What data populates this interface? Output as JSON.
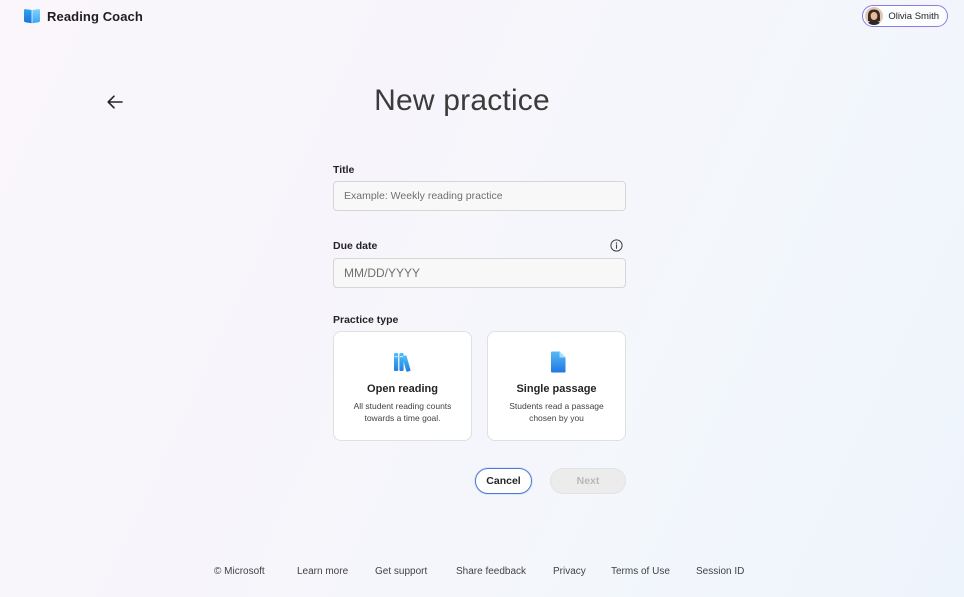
{
  "header": {
    "app_name": "Reading Coach",
    "user_name": "Olivia Smith"
  },
  "page": {
    "title": "New practice"
  },
  "form": {
    "title_label": "Title",
    "title_placeholder": "Example: Weekly reading practice",
    "title_value": "",
    "due_date_label": "Due date",
    "due_date_placeholder": "MM/DD/YYYY",
    "due_date_value": "",
    "practice_type_label": "Practice type"
  },
  "practice_types": [
    {
      "title": "Open reading",
      "description": "All student reading counts towards a time goal.",
      "icon": "books-icon"
    },
    {
      "title": "Single passage",
      "description": "Students read a passage chosen by you",
      "icon": "document-icon"
    }
  ],
  "actions": {
    "cancel_label": "Cancel",
    "next_label": "Next"
  },
  "footer": {
    "copyright": "© Microsoft",
    "learn_more": "Learn more",
    "get_support": "Get support",
    "share_feedback": "Share feedback",
    "privacy": "Privacy",
    "terms": "Terms of Use",
    "session_id": "Session ID"
  },
  "colors": {
    "accent": "#4e7bd8",
    "profile_border": "#8f78e8",
    "icon_blue": "#2f9bf0",
    "disabled_bg": "#ececec"
  }
}
